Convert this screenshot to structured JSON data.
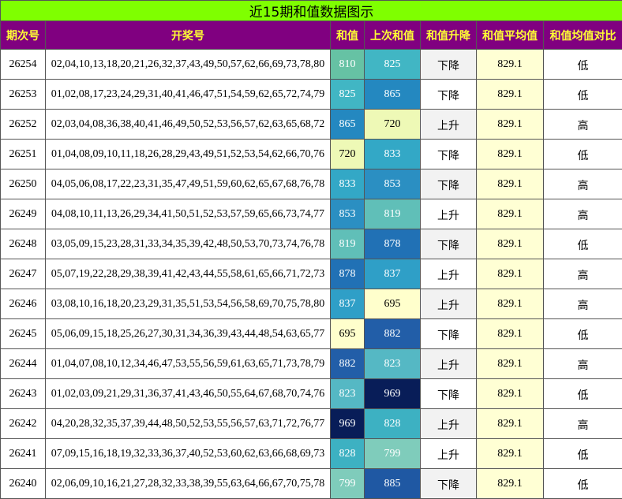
{
  "title": "近15期和值数据图示",
  "headers": [
    "期次号",
    "开奖号",
    "和值",
    "上次和值",
    "和值升降",
    "和值平均值",
    "和值均值对比"
  ],
  "colors": {
    "title_bg": "#7fff00",
    "header_bg": "#800080",
    "header_text": "#ffff33",
    "dir_bg_alt": "#f2f2f2",
    "avg_bg": "#ffffd4"
  },
  "value_colors": {
    "695": "#ffffcc",
    "720": "#eef9b6",
    "799": "#7fccbb",
    "810": "#66c2a4",
    "819": "#60bfb8",
    "823": "#55b8c4",
    "825": "#41b6c4",
    "828": "#3db1c2",
    "833": "#33a8c6",
    "837": "#2f9fc7",
    "853": "#2b8fc2",
    "865": "#2488c0",
    "878": "#2171b5",
    "882": "#225ea8",
    "885": "#1f58a3",
    "969": "#081d58"
  },
  "rows": [
    {
      "issue": "26254",
      "numbers": "02,04,10,13,18,20,21,26,32,37,43,49,50,57,62,66,69,73,78,80",
      "sum": "810",
      "prev": "825",
      "dir": "下降",
      "avg": "829.1",
      "cmp": "低"
    },
    {
      "issue": "26253",
      "numbers": "01,02,08,17,23,24,29,31,40,41,46,47,51,54,59,62,65,72,74,79",
      "sum": "825",
      "prev": "865",
      "dir": "下降",
      "avg": "829.1",
      "cmp": "低"
    },
    {
      "issue": "26252",
      "numbers": "02,03,04,08,36,38,40,41,46,49,50,52,53,56,57,62,63,65,68,72",
      "sum": "865",
      "prev": "720",
      "dir": "上升",
      "avg": "829.1",
      "cmp": "高"
    },
    {
      "issue": "26251",
      "numbers": "01,04,08,09,10,11,18,26,28,29,43,49,51,52,53,54,62,66,70,76",
      "sum": "720",
      "prev": "833",
      "dir": "下降",
      "avg": "829.1",
      "cmp": "低"
    },
    {
      "issue": "26250",
      "numbers": "04,05,06,08,17,22,23,31,35,47,49,51,59,60,62,65,67,68,76,78",
      "sum": "833",
      "prev": "853",
      "dir": "下降",
      "avg": "829.1",
      "cmp": "高"
    },
    {
      "issue": "26249",
      "numbers": "04,08,10,11,13,26,29,34,41,50,51,52,53,57,59,65,66,73,74,77",
      "sum": "853",
      "prev": "819",
      "dir": "上升",
      "avg": "829.1",
      "cmp": "高"
    },
    {
      "issue": "26248",
      "numbers": "03,05,09,15,23,28,31,33,34,35,39,42,48,50,53,70,73,74,76,78",
      "sum": "819",
      "prev": "878",
      "dir": "下降",
      "avg": "829.1",
      "cmp": "低"
    },
    {
      "issue": "26247",
      "numbers": "05,07,19,22,28,29,38,39,41,42,43,44,55,58,61,65,66,71,72,73",
      "sum": "878",
      "prev": "837",
      "dir": "上升",
      "avg": "829.1",
      "cmp": "高"
    },
    {
      "issue": "26246",
      "numbers": "03,08,10,16,18,20,23,29,31,35,51,53,54,56,58,69,70,75,78,80",
      "sum": "837",
      "prev": "695",
      "dir": "上升",
      "avg": "829.1",
      "cmp": "高"
    },
    {
      "issue": "26245",
      "numbers": "05,06,09,15,18,25,26,27,30,31,34,36,39,43,44,48,54,63,65,77",
      "sum": "695",
      "prev": "882",
      "dir": "下降",
      "avg": "829.1",
      "cmp": "低"
    },
    {
      "issue": "26244",
      "numbers": "01,04,07,08,10,12,34,46,47,53,55,56,59,61,63,65,71,73,78,79",
      "sum": "882",
      "prev": "823",
      "dir": "上升",
      "avg": "829.1",
      "cmp": "高"
    },
    {
      "issue": "26243",
      "numbers": "01,02,03,09,21,29,31,36,37,41,43,46,50,55,64,67,68,70,74,76",
      "sum": "823",
      "prev": "969",
      "dir": "下降",
      "avg": "829.1",
      "cmp": "低"
    },
    {
      "issue": "26242",
      "numbers": "04,20,28,32,35,37,39,44,48,50,52,53,55,56,57,63,71,72,76,77",
      "sum": "969",
      "prev": "828",
      "dir": "上升",
      "avg": "829.1",
      "cmp": "高"
    },
    {
      "issue": "26241",
      "numbers": "07,09,15,16,18,19,32,33,36,37,40,52,53,60,62,63,66,68,69,73",
      "sum": "828",
      "prev": "799",
      "dir": "上升",
      "avg": "829.1",
      "cmp": "低"
    },
    {
      "issue": "26240",
      "numbers": "02,06,09,10,16,21,27,28,32,33,38,39,55,63,64,66,67,70,75,78",
      "sum": "799",
      "prev": "885",
      "dir": "下降",
      "avg": "829.1",
      "cmp": "低"
    }
  ]
}
